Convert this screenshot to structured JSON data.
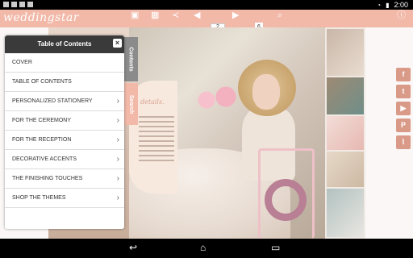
{
  "status_bar": {
    "clock": "2:00"
  },
  "toolbar": {
    "logo": "weddingstar",
    "page_current": "2",
    "page_total": "6"
  },
  "magazine": {
    "script_text": "details."
  },
  "toc": {
    "title": "Table of Contents",
    "close": "×",
    "items": [
      {
        "label": "COVER",
        "has_chevron": false
      },
      {
        "label": "TABLE OF CONTENTS",
        "has_chevron": false
      },
      {
        "label": "PERSONALIZED STATIONERY",
        "has_chevron": true
      },
      {
        "label": "FOR THE CEREMONY",
        "has_chevron": true
      },
      {
        "label": "FOR THE RECEPTION",
        "has_chevron": true
      },
      {
        "label": "DECORATIVE ACCENTS",
        "has_chevron": true
      },
      {
        "label": "THE FINISHING TOUCHES",
        "has_chevron": true
      },
      {
        "label": "SHOP THE THEMES",
        "has_chevron": true
      }
    ]
  },
  "side_tabs": {
    "contents": "Contents",
    "search": "Search"
  },
  "social": {
    "icons": [
      "facebook-icon",
      "twitter-icon",
      "youtube-icon",
      "pinterest-icon",
      "rss-icon"
    ]
  },
  "colors": {
    "accent": "#f2b8a8",
    "social": "#d99a87"
  }
}
